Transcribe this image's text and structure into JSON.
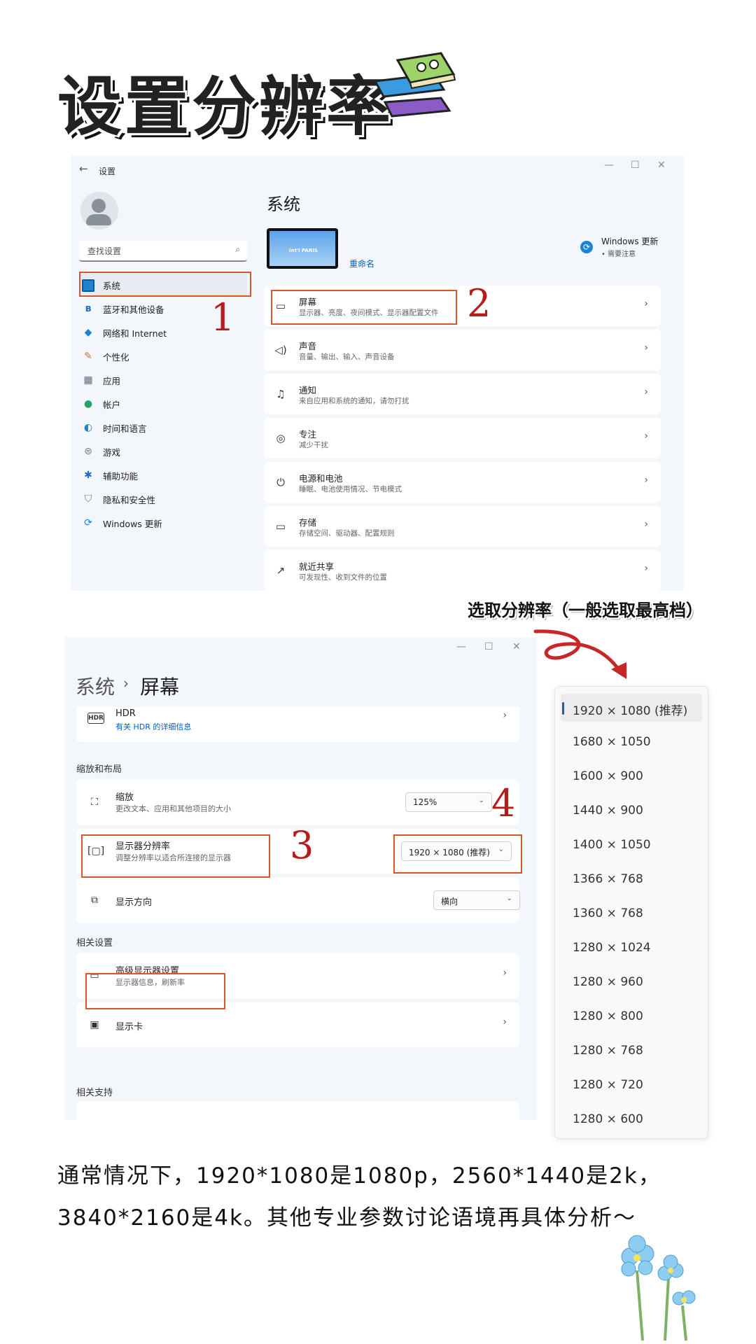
{
  "header": {
    "title": "设置分辨率"
  },
  "window1": {
    "app_title": "设置",
    "search": {
      "placeholder": "查找设置"
    },
    "sidebar": {
      "items": [
        {
          "label": "系统",
          "icon": "monitor-icon"
        },
        {
          "label": "蓝牙和其他设备",
          "icon": "bluetooth-icon"
        },
        {
          "label": "网络和 Internet",
          "icon": "wifi-icon"
        },
        {
          "label": "个性化",
          "icon": "brush-icon"
        },
        {
          "label": "应用",
          "icon": "apps-icon"
        },
        {
          "label": "帐户",
          "icon": "account-icon"
        },
        {
          "label": "时间和语言",
          "icon": "globe-clock-icon"
        },
        {
          "label": "游戏",
          "icon": "gamepad-icon"
        },
        {
          "label": "辅助功能",
          "icon": "accessibility-icon"
        },
        {
          "label": "隐私和安全性",
          "icon": "shield-icon"
        },
        {
          "label": "Windows 更新",
          "icon": "update-icon"
        }
      ]
    },
    "main": {
      "title": "系统",
      "monitor_caption": "Int'l PARIS",
      "rename": "重命名",
      "windows_update": {
        "title": "Windows 更新",
        "subtitle": "• 需要注意"
      },
      "cards": [
        {
          "title": "屏幕",
          "desc": "显示器、亮度、夜间模式、显示器配置文件",
          "icon": "display-icon"
        },
        {
          "title": "声音",
          "desc": "音量、输出、输入、声音设备",
          "icon": "speaker-icon"
        },
        {
          "title": "通知",
          "desc": "来自应用和系统的通知，请勿打扰",
          "icon": "bell-icon"
        },
        {
          "title": "专注",
          "desc": "减少干扰",
          "icon": "focus-icon"
        },
        {
          "title": "电源和电池",
          "desc": "睡眠、电池使用情况、节电模式",
          "icon": "power-icon"
        },
        {
          "title": "存储",
          "desc": "存储空间、驱动器、配置规则",
          "icon": "storage-icon"
        },
        {
          "title": "就近共享",
          "desc": "可发现性、收到文件的位置",
          "icon": "share-icon"
        }
      ]
    },
    "step_numbers": {
      "one": "1",
      "two": "2"
    }
  },
  "window2": {
    "breadcrumb": {
      "parent": "系统",
      "sep": "›",
      "current": "屏幕"
    },
    "hdr": {
      "title": "HDR",
      "link": "有关 HDR 的详细信息"
    },
    "section_scale_layout": "缩放和布局",
    "scale": {
      "title": "缩放",
      "desc": "更改文本、应用和其他项目的大小",
      "value": "125%"
    },
    "resolution": {
      "title": "显示器分辨率",
      "desc": "调整分辨率以适合所连接的显示器",
      "value": "1920 × 1080 (推荐)"
    },
    "orientation": {
      "title": "显示方向",
      "value": "横向"
    },
    "section_related": "相关设置",
    "advanced": {
      "title": "高级显示器设置",
      "desc": "显示器信息，刷新率"
    },
    "graphics": {
      "title": "显示卡"
    },
    "section_support": "相关支持",
    "step_numbers": {
      "three": "3",
      "four": "4"
    }
  },
  "annotation": {
    "title": "选取分辨率（一般选取最高档）"
  },
  "resolution_list": {
    "selected_index": 0,
    "options": [
      "1920 × 1080 (推荐)",
      "1680 × 1050",
      "1600 × 900",
      "1440 × 900",
      "1400 × 1050",
      "1366 × 768",
      "1360 × 768",
      "1280 × 1024",
      "1280 × 960",
      "1280 × 800",
      "1280 × 768",
      "1280 × 720",
      "1280 × 600"
    ]
  },
  "footer": {
    "text": "通常情况下，1920*1080是1080p，2560*1440是2k，3840*2160是4k。其他专业参数讨论语境再具体分析～"
  },
  "colors": {
    "accent": "#1a5fb4",
    "highlight_box": "#d4582a",
    "step_number": "#b71c1c"
  }
}
